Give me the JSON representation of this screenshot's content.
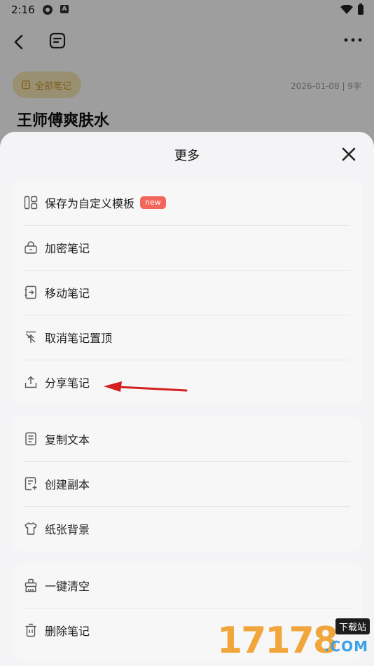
{
  "status_bar": {
    "time": "2:16"
  },
  "header": {
    "back_icon": "chevron-left-icon",
    "format_icon": "text-format-icon",
    "more_icon": "more-dots-icon"
  },
  "note": {
    "folder": "全部笔记",
    "meta": "2026-01-08 | 9字",
    "title": "王师傅爽肤水"
  },
  "sheet": {
    "title": "更多",
    "close_icon": "close-icon",
    "groups": [
      [
        {
          "label": "保存为自定义模板",
          "badge": "new",
          "icon": "template-icon"
        },
        {
          "label": "加密笔记",
          "icon": "lock-icon"
        },
        {
          "label": "移动笔记",
          "icon": "move-icon"
        },
        {
          "label": "取消笔记置顶",
          "icon": "unpin-icon"
        },
        {
          "label": "分享笔记",
          "icon": "share-icon"
        }
      ],
      [
        {
          "label": "复制文本",
          "icon": "copy-text-icon"
        },
        {
          "label": "创建副本",
          "icon": "duplicate-icon"
        },
        {
          "label": "纸张背景",
          "icon": "paper-background-icon"
        }
      ],
      [
        {
          "label": "一键清空",
          "icon": "clear-icon"
        },
        {
          "label": "删除笔记",
          "icon": "delete-icon"
        }
      ]
    ]
  },
  "watermark": {
    "digits": "17178",
    "tag": "下载站",
    "suffix": ".COM"
  },
  "colors": {
    "badge": "#f2665b",
    "folder_chip_bg": "#f7e9b8",
    "folder_chip_text": "#c99a2c",
    "annotation_arrow": "#d32020"
  }
}
